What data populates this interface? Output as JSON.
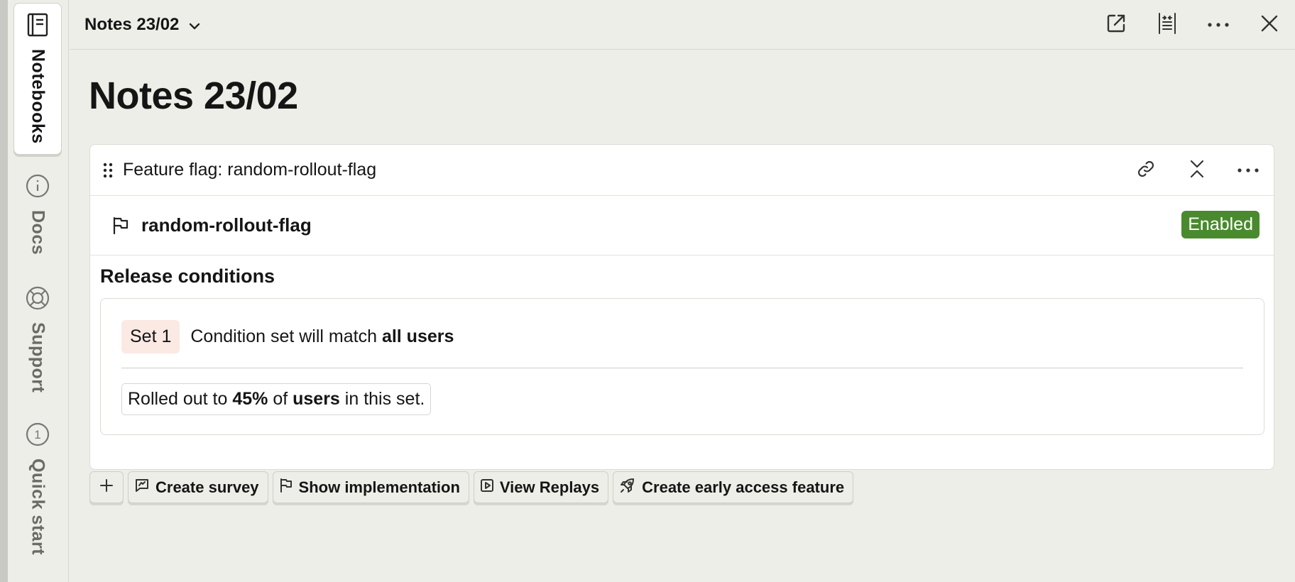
{
  "sidebar": {
    "tabs": [
      {
        "label": "Notebooks",
        "icon": "notebook-icon"
      },
      {
        "label": "Docs",
        "icon": "info-icon"
      },
      {
        "label": "Support",
        "icon": "lifebuoy-icon"
      },
      {
        "label": "Quick start",
        "icon": "step-one-icon",
        "badge": "1"
      }
    ]
  },
  "header": {
    "title": "Notes 23/02",
    "actions": [
      "open-external-icon",
      "collapse-width-icon",
      "more-icon",
      "close-icon"
    ]
  },
  "page": {
    "title": "Notes 23/02"
  },
  "card": {
    "title": "Feature flag: random-rollout-flag",
    "flag_key": "random-rollout-flag",
    "status": "Enabled",
    "section_title": "Release conditions",
    "condition_set": {
      "label": "Set 1",
      "text_prefix": "Condition set will match ",
      "text_bold": "all users",
      "rollout_prefix": "Rolled out to ",
      "rollout_percent": "45%",
      "rollout_mid": " of ",
      "rollout_users": "users",
      "rollout_suffix": " in this set."
    }
  },
  "actions": {
    "add_label": "+",
    "create_survey": "Create survey",
    "show_implementation": "Show implementation",
    "view_replays": "View Replays",
    "create_early_access": "Create early access feature"
  },
  "colors": {
    "background": "#eeeee8",
    "enabled_badge": "#4a8a2e",
    "set_pill": "#fbe9e3"
  }
}
